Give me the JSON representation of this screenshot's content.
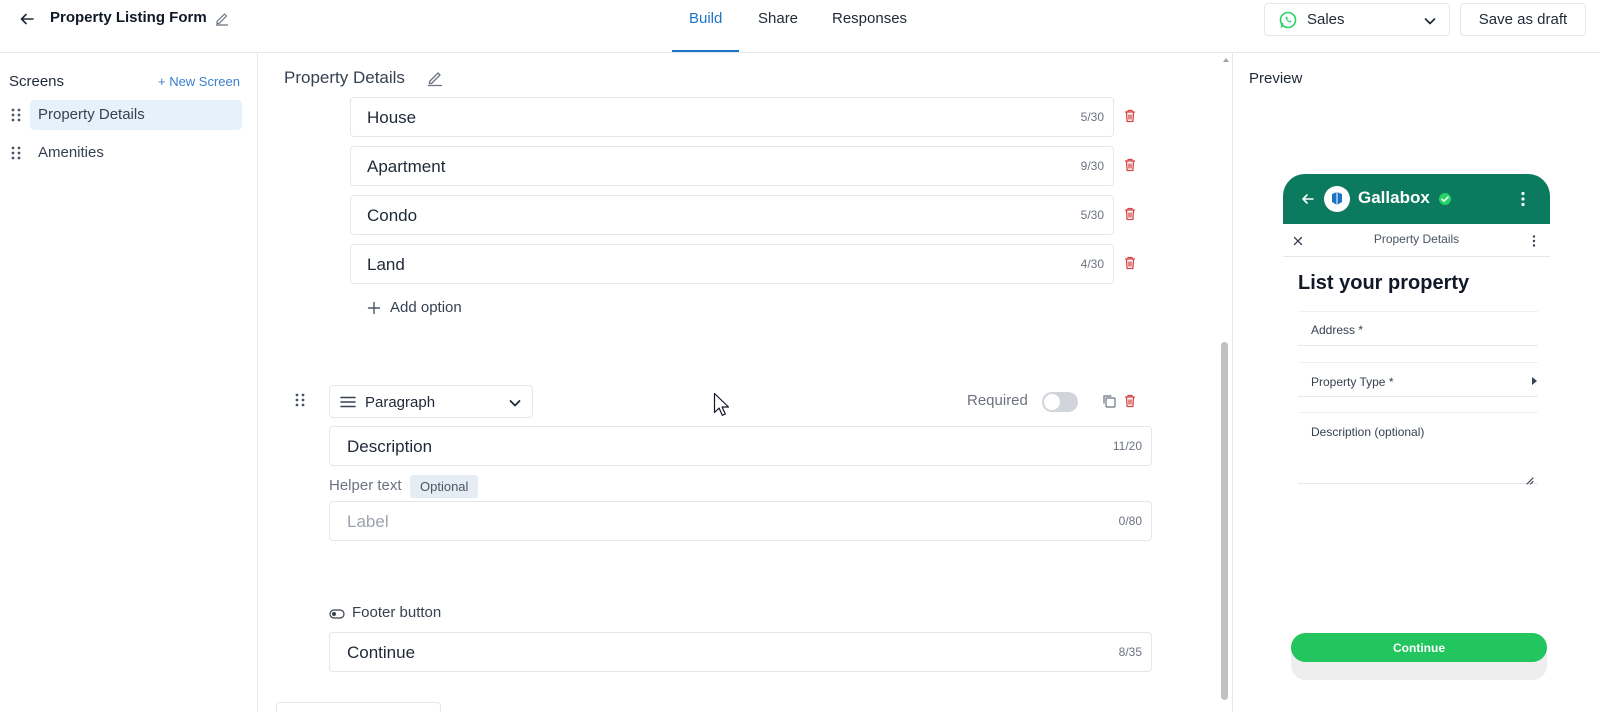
{
  "header": {
    "title": "Property Listing Form",
    "tabs": [
      {
        "label": "Build",
        "active": true
      },
      {
        "label": "Share",
        "active": false
      },
      {
        "label": "Responses",
        "active": false
      }
    ],
    "channel": {
      "label": "Sales",
      "icon": "whatsapp-icon"
    },
    "save_draft_label": "Save as draft"
  },
  "sidebar": {
    "title": "Screens",
    "new_screen_label": "+ New Screen",
    "items": [
      {
        "label": "Property Details",
        "selected": true
      },
      {
        "label": "Amenities",
        "selected": false
      }
    ]
  },
  "editor": {
    "screen_title": "Property Details",
    "options": [
      {
        "label": "House",
        "counter": "5/30"
      },
      {
        "label": "Apartment",
        "counter": "9/30"
      },
      {
        "label": "Condo",
        "counter": "5/30"
      },
      {
        "label": "Land",
        "counter": "4/30"
      }
    ],
    "add_option_label": "Add option",
    "paragraph_field": {
      "type_label": "Paragraph",
      "required_label": "Required",
      "required": false,
      "label_value": "Description",
      "label_counter": "11/20",
      "helper_label": "Helper text",
      "optional_badge": "Optional",
      "helper_placeholder": "Label",
      "helper_counter": "0/80"
    },
    "footer_button": {
      "label": "Footer button",
      "value": "Continue",
      "counter": "8/35"
    }
  },
  "preview": {
    "title": "Preview",
    "brand_name": "Gallabox",
    "flow_title": "Property Details",
    "heading": "List your property",
    "fields": [
      "Address *",
      "Property Type *",
      "Description (optional)"
    ],
    "button_label": "Continue"
  },
  "colors": {
    "accent": "#1d74c7",
    "whatsapp_header": "#0b7a5e",
    "continue_green": "#22c55e",
    "delete_red": "#d64545",
    "selected_bg": "#e6f2fb"
  }
}
